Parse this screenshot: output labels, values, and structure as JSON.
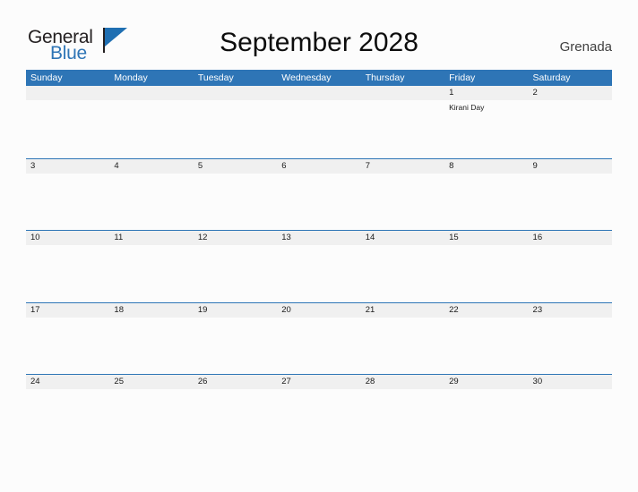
{
  "brand": {
    "name_part1": "General",
    "name_part2": "Blue",
    "color_dark": "#231f20",
    "color_blue": "#2e75b6"
  },
  "header": {
    "title": "September 2028",
    "location": "Grenada"
  },
  "calendar": {
    "accent_color": "#2e75b6",
    "band_color": "#f0f0f0",
    "weekdays": [
      "Sunday",
      "Monday",
      "Tuesday",
      "Wednesday",
      "Thursday",
      "Friday",
      "Saturday"
    ],
    "weeks": [
      {
        "days": [
          {
            "number": "",
            "events": []
          },
          {
            "number": "",
            "events": []
          },
          {
            "number": "",
            "events": []
          },
          {
            "number": "",
            "events": []
          },
          {
            "number": "",
            "events": []
          },
          {
            "number": "1",
            "events": [
              "Kirani Day"
            ]
          },
          {
            "number": "2",
            "events": []
          }
        ]
      },
      {
        "days": [
          {
            "number": "3",
            "events": []
          },
          {
            "number": "4",
            "events": []
          },
          {
            "number": "5",
            "events": []
          },
          {
            "number": "6",
            "events": []
          },
          {
            "number": "7",
            "events": []
          },
          {
            "number": "8",
            "events": []
          },
          {
            "number": "9",
            "events": []
          }
        ]
      },
      {
        "days": [
          {
            "number": "10",
            "events": []
          },
          {
            "number": "11",
            "events": []
          },
          {
            "number": "12",
            "events": []
          },
          {
            "number": "13",
            "events": []
          },
          {
            "number": "14",
            "events": []
          },
          {
            "number": "15",
            "events": []
          },
          {
            "number": "16",
            "events": []
          }
        ]
      },
      {
        "days": [
          {
            "number": "17",
            "events": []
          },
          {
            "number": "18",
            "events": []
          },
          {
            "number": "19",
            "events": []
          },
          {
            "number": "20",
            "events": []
          },
          {
            "number": "21",
            "events": []
          },
          {
            "number": "22",
            "events": []
          },
          {
            "number": "23",
            "events": []
          }
        ]
      },
      {
        "days": [
          {
            "number": "24",
            "events": []
          },
          {
            "number": "25",
            "events": []
          },
          {
            "number": "26",
            "events": []
          },
          {
            "number": "27",
            "events": []
          },
          {
            "number": "28",
            "events": []
          },
          {
            "number": "29",
            "events": []
          },
          {
            "number": "30",
            "events": []
          }
        ]
      }
    ]
  }
}
